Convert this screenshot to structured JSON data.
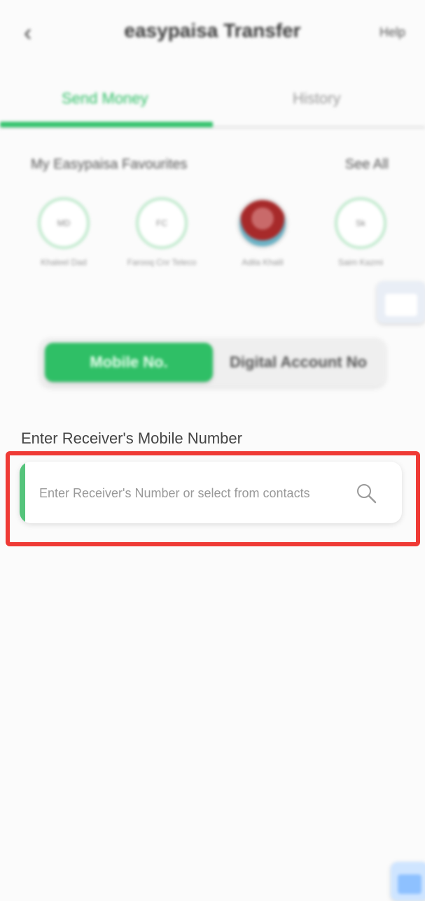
{
  "header": {
    "back_icon": "chevron-left-icon",
    "title": "easypaisa Transfer",
    "help_label": "Help"
  },
  "tabs": [
    {
      "label": "Send Money",
      "active": true
    },
    {
      "label": "History",
      "active": false
    }
  ],
  "favourites": {
    "title": "My Easypaisa Favourites",
    "see_all": "See All",
    "items": [
      {
        "initials": "MD",
        "name": "Khaleel Dad"
      },
      {
        "initials": "FC",
        "name": "Farooq Cnr Teleco"
      },
      {
        "initials": "",
        "name": "Adila Khalil"
      },
      {
        "initials": "Sk",
        "name": "Saim Kazmi"
      }
    ]
  },
  "segment": {
    "options": [
      "Mobile No.",
      "Digital Account No"
    ],
    "selected": "Mobile No."
  },
  "receiver": {
    "label": "Enter Receiver's Mobile Number",
    "placeholder": "Enter Receiver's Number or select from contacts",
    "search_icon": "search-icon"
  },
  "colors": {
    "accent_green": "#2fbf66",
    "highlight_red": "#ef3a35"
  }
}
